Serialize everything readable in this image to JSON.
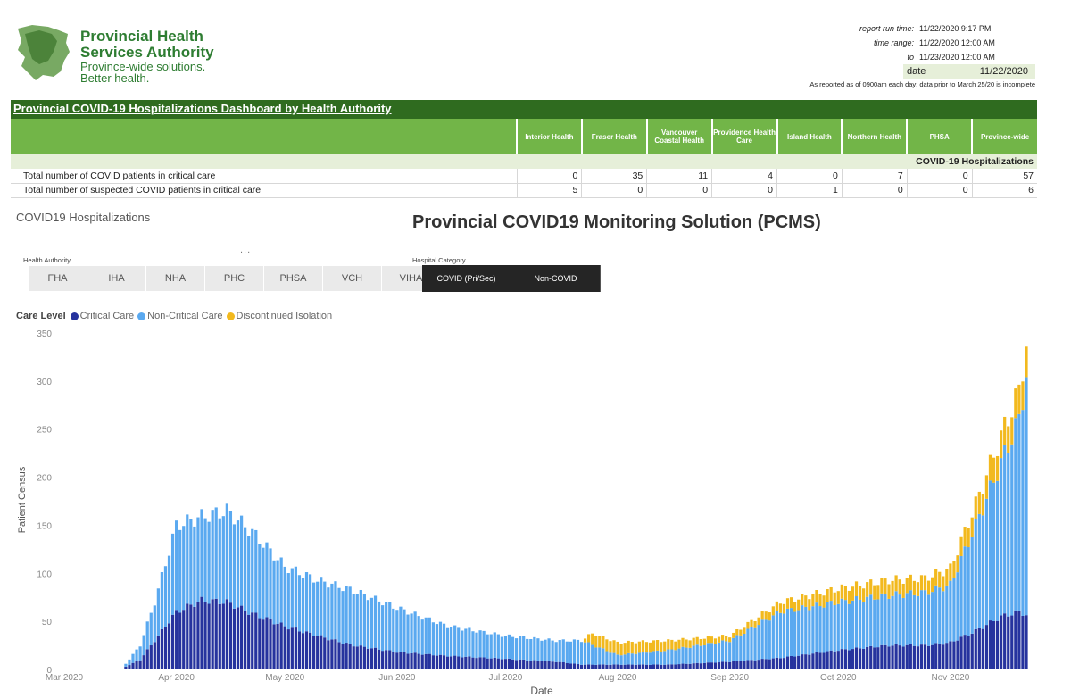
{
  "header": {
    "org_name_line1": "Provincial Health",
    "org_name_line2": "Services Authority",
    "tagline_line1": "Province-wide solutions.",
    "tagline_line2": "Better health.",
    "meta": [
      {
        "label": "report run time:",
        "value": "11/22/2020 9:17 PM"
      },
      {
        "label": "time range:",
        "value": "11/22/2020 12:00 AM"
      },
      {
        "label": "to",
        "value": "11/23/2020 12:00 AM"
      }
    ],
    "date_label": "date",
    "date_value": "11/22/2020",
    "note": "As reported as of 0900am each day; data prior to March 25/20 is incomplete"
  },
  "dashboard": {
    "title": "Provincial COVID-19 Hospitalizations Dashboard by Health Authority",
    "columns": [
      "Interior Health",
      "Fraser Health",
      "Vancouver Coastal Health",
      "Providence Health Care",
      "Island Health",
      "Northern Health",
      "PHSA",
      "Province-wide"
    ],
    "section": "COVID-19 Hospitalizations",
    "rows": [
      {
        "label": "Total number of COVID patients in critical care",
        "values": [
          "0",
          "35",
          "11",
          "4",
          "0",
          "7",
          "0",
          "57"
        ]
      },
      {
        "label": "Total number of suspected COVID patients in critical care",
        "values": [
          "5",
          "0",
          "0",
          "0",
          "1",
          "0",
          "0",
          "6"
        ]
      }
    ]
  },
  "report": {
    "subtitle": "COVID19 Hospitalizations",
    "title": "Provincial COVID19 Monitoring Solution (PCMS)",
    "dots": "...",
    "health_authority_label": "Health Authority",
    "health_authority_options": [
      "FHA",
      "IHA",
      "NHA",
      "PHC",
      "PHSA",
      "VCH",
      "VIHA"
    ],
    "hospital_category_label": "Hospital Category",
    "hospital_category_options": [
      "COVID (Pri/Sec)",
      "Non-COVID"
    ],
    "legend_title": "Care Level"
  },
  "colors": {
    "critical": "#26339e",
    "non_critical": "#5aa9f0",
    "discontinued": "#f2b91e",
    "header_green": "#2f6b1f",
    "column_green": "#72b548"
  },
  "chart_data": {
    "type": "bar",
    "stacked": true,
    "xlabel": "Date",
    "ylabel": "Patient Census",
    "ylim": [
      0,
      350
    ],
    "yticks": [
      0,
      50,
      100,
      150,
      200,
      250,
      300,
      350
    ],
    "x_start": "2020-03-01",
    "x_end": "2020-11-22",
    "xticks": [
      "Mar 2020",
      "Apr 2020",
      "May 2020",
      "Jun 2020",
      "Jul 2020",
      "Aug 2020",
      "Sep 2020",
      "Oct 2020",
      "Nov 2020"
    ],
    "legend_position": "top-left",
    "grid": false,
    "series": [
      {
        "name": "Critical Care",
        "anchors": [
          [
            "2020-03-18",
            3
          ],
          [
            "2020-03-22",
            10
          ],
          [
            "2020-03-26",
            30
          ],
          [
            "2020-04-01",
            60
          ],
          [
            "2020-04-08",
            72
          ],
          [
            "2020-04-15",
            70
          ],
          [
            "2020-04-22",
            58
          ],
          [
            "2020-05-01",
            45
          ],
          [
            "2020-05-10",
            35
          ],
          [
            "2020-05-20",
            25
          ],
          [
            "2020-06-01",
            18
          ],
          [
            "2020-06-15",
            14
          ],
          [
            "2020-07-01",
            11
          ],
          [
            "2020-07-15",
            8
          ],
          [
            "2020-07-22",
            5
          ],
          [
            "2020-08-15",
            5
          ],
          [
            "2020-09-01",
            8
          ],
          [
            "2020-09-15",
            12
          ],
          [
            "2020-10-01",
            20
          ],
          [
            "2020-10-15",
            25
          ],
          [
            "2020-10-25",
            25
          ],
          [
            "2020-11-01",
            28
          ],
          [
            "2020-11-08",
            40
          ],
          [
            "2020-11-15",
            55
          ],
          [
            "2020-11-20",
            60
          ],
          [
            "2020-11-22",
            57
          ]
        ]
      },
      {
        "name": "Non-Critical Care",
        "anchors": [
          [
            "2020-03-18",
            3
          ],
          [
            "2020-03-22",
            15
          ],
          [
            "2020-03-26",
            40
          ],
          [
            "2020-04-01",
            90
          ],
          [
            "2020-04-08",
            87
          ],
          [
            "2020-04-15",
            95
          ],
          [
            "2020-04-22",
            85
          ],
          [
            "2020-05-01",
            62
          ],
          [
            "2020-05-10",
            58
          ],
          [
            "2020-05-20",
            57
          ],
          [
            "2020-06-01",
            46
          ],
          [
            "2020-06-15",
            31
          ],
          [
            "2020-07-01",
            24
          ],
          [
            "2020-07-15",
            22
          ],
          [
            "2020-07-22",
            25
          ],
          [
            "2020-08-01",
            10
          ],
          [
            "2020-08-15",
            15
          ],
          [
            "2020-09-01",
            22
          ],
          [
            "2020-09-15",
            48
          ],
          [
            "2020-10-01",
            50
          ],
          [
            "2020-10-15",
            52
          ],
          [
            "2020-10-25",
            55
          ],
          [
            "2020-11-01",
            60
          ],
          [
            "2020-11-08",
            110
          ],
          [
            "2020-11-15",
            160
          ],
          [
            "2020-11-20",
            200
          ],
          [
            "2020-11-22",
            250
          ]
        ]
      },
      {
        "name": "Discontinued Isolation",
        "anchors": [
          [
            "2020-03-18",
            0
          ],
          [
            "2020-07-22",
            0
          ],
          [
            "2020-07-25",
            12
          ],
          [
            "2020-08-01",
            13
          ],
          [
            "2020-08-15",
            10
          ],
          [
            "2020-09-01",
            5
          ],
          [
            "2020-09-15",
            10
          ],
          [
            "2020-10-01",
            14
          ],
          [
            "2020-10-15",
            16
          ],
          [
            "2020-10-25",
            15
          ],
          [
            "2020-11-01",
            17
          ],
          [
            "2020-11-08",
            22
          ],
          [
            "2020-11-15",
            28
          ],
          [
            "2020-11-20",
            30
          ],
          [
            "2020-11-22",
            32
          ]
        ]
      }
    ]
  }
}
